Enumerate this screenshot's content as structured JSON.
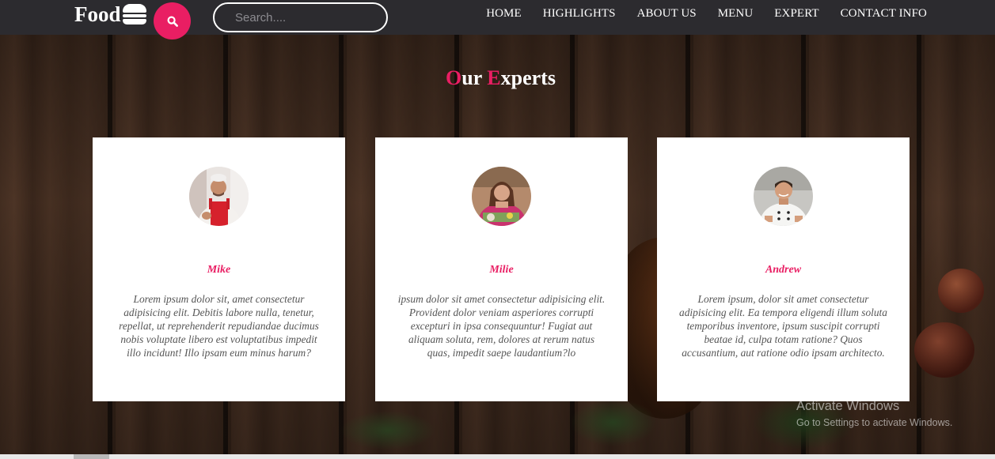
{
  "header": {
    "logo_text": "Food",
    "search": {
      "placeholder": "Search...."
    },
    "nav": [
      {
        "label": "HOME"
      },
      {
        "label": "HIGHLIGHTS"
      },
      {
        "label": "ABOUT US"
      },
      {
        "label": "MENU"
      },
      {
        "label": "EXPERT"
      },
      {
        "label": "CONTACT INFO"
      }
    ]
  },
  "section": {
    "title_first_initial": "O",
    "title_first_rest": "ur",
    "title_second_initial": "E",
    "title_second_rest": "xperts"
  },
  "experts": [
    {
      "name": "Mike",
      "text": "Lorem ipsum dolor sit, amet consectetur adipisicing elit. Debitis labore nulla, tenetur, repellat, ut reprehenderit repudiandae ducimus nobis voluptate libero est voluptatibus impedit illo incidunt! Illo ipsam eum minus harum?"
    },
    {
      "name": "Milie",
      "text": "ipsum dolor sit amet consectetur adipisicing elit. Provident dolor veniam asperiores corrupti excepturi in ipsa consequuntur! Fugiat aut aliquam soluta, rem, dolores at rerum natus quas, impedit saepe laudantium?lo"
    },
    {
      "name": "Andrew",
      "text": "Lorem ipsum, dolor sit amet consectetur adipisicing elit. Ea tempora eligendi illum soluta temporibus inventore, ipsum suscipit corrupti beatae id, culpa totam ratione? Quos accusantium, aut ratione odio ipsam architecto."
    }
  ],
  "watermark": {
    "title": "Activate Windows",
    "subtitle": "Go to Settings to activate Windows."
  },
  "colors": {
    "accent": "#e91e63",
    "navbar": "#2c2b2f",
    "card": "#ffffff"
  },
  "icons": {
    "logo": "burger-icon",
    "search": "search-icon"
  }
}
